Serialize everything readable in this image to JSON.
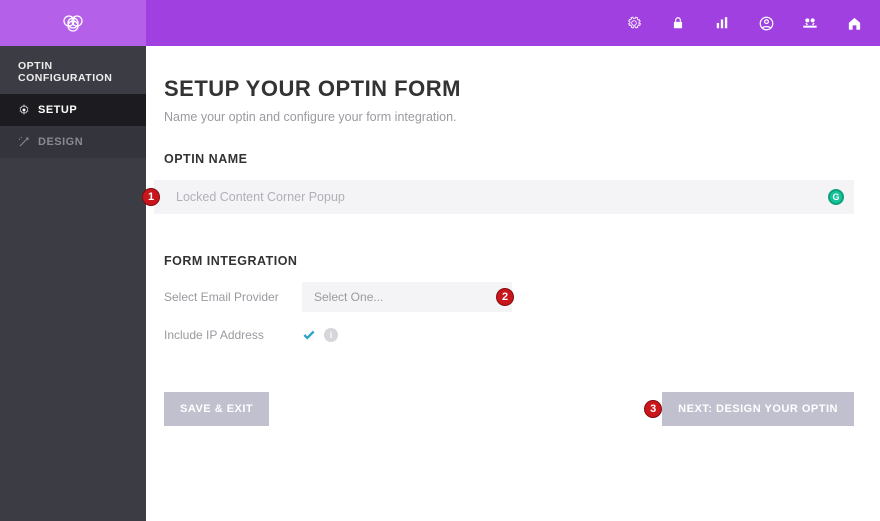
{
  "sidebar": {
    "header": "OPTIN CONFIGURATION",
    "items": [
      {
        "label": "SETUP"
      },
      {
        "label": "DESIGN"
      }
    ]
  },
  "page": {
    "title": "SETUP YOUR OPTIN FORM",
    "subtitle": "Name your optin and configure your form integration."
  },
  "sections": {
    "optin_name": {
      "label": "OPTIN NAME",
      "value": "Locked Content Corner Popup"
    },
    "form_integration": {
      "label": "FORM INTEGRATION",
      "provider_label": "Select Email Provider",
      "provider_value": "Select One...",
      "ip_label": "Include IP Address"
    }
  },
  "buttons": {
    "save": "SAVE & EXIT",
    "next": "NEXT: DESIGN YOUR OPTIN"
  },
  "badges": {
    "b1": "1",
    "b2": "2",
    "b3": "3"
  }
}
